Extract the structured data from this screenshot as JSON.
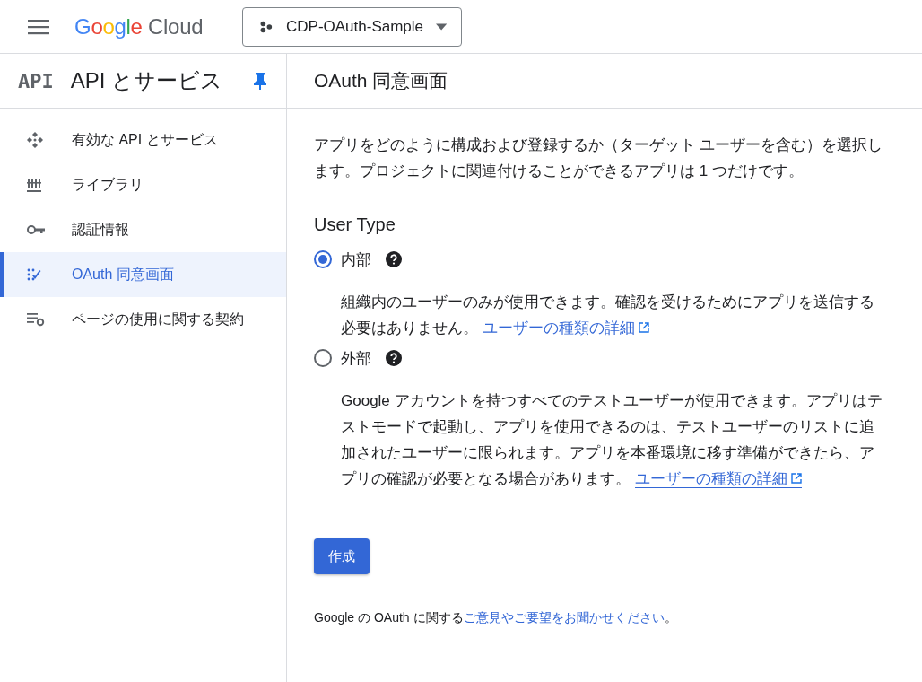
{
  "topbar": {
    "logo": "Google Cloud",
    "project": "CDP-OAuth-Sample"
  },
  "sidebar": {
    "badge": "API",
    "title": "API とサービス",
    "pinned": true,
    "items": [
      {
        "kind": "enabled",
        "label": "有効な API とサービス",
        "selected": false
      },
      {
        "kind": "library",
        "label": "ライブラリ",
        "selected": false
      },
      {
        "kind": "credentials",
        "label": "認証情報",
        "selected": false
      },
      {
        "kind": "consent",
        "label": "OAuth 同意画面",
        "selected": true
      },
      {
        "kind": "terms",
        "label": "ページの使用に関する契約",
        "selected": false
      }
    ]
  },
  "page": {
    "title": "OAuth 同意画面",
    "intro": "アプリをどのように構成および登録するか（ターゲット ユーザーを含む）を選択します。プロジェクトに関連付けることができるアプリは 1 つだけです。",
    "section_title": "User Type",
    "options": [
      {
        "label": "内部",
        "selected": true,
        "description": "組織内のユーザーのみが使用できます。確認を受けるためにアプリを送信する必要はありません。",
        "link": "ユーザーの種類の詳細"
      },
      {
        "label": "外部",
        "selected": false,
        "description": "Google アカウントを持つすべてのテストユーザーが使用できます。アプリはテストモードで起動し、アプリを使用できるのは、テストユーザーのリストに追加されたユーザーに限られます。アプリを本番環境に移す準備ができたら、アプリの確認が必要となる場合があります。",
        "link": "ユーザーの種類の詳細"
      }
    ],
    "create_button": "作成",
    "feedback": {
      "before": "Google の OAuth に関する",
      "link": "ご意見やご要望をお聞かせください",
      "after": "。"
    }
  }
}
